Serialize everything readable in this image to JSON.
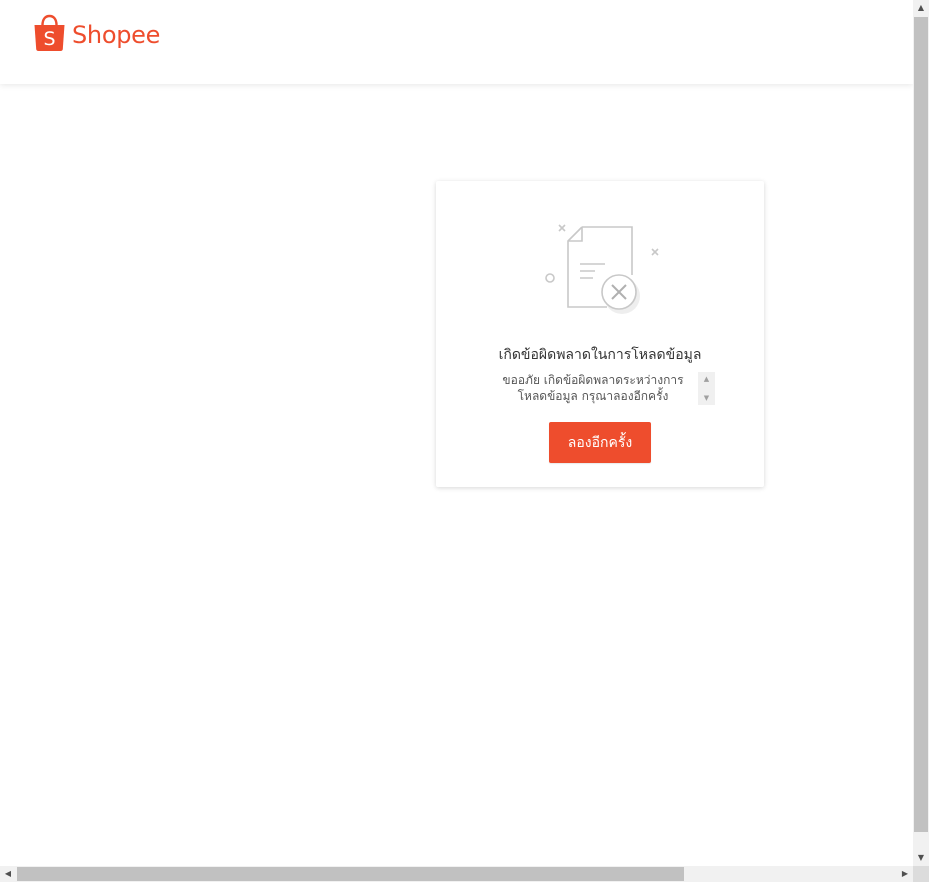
{
  "header": {
    "logo_text": "Shopee",
    "logo_bag_letter": "S"
  },
  "error_card": {
    "illustration": "document-error-icon",
    "title": "เกิดข้อผิดพลาดในการโหลดข้อมูล",
    "message_line1": "ขออภัย เกิดข้อผิดพลาดระหว่างการ",
    "message_line2": "โหลดข้อมูล กรุณาลองอีกครั้ง",
    "retry_label": "ลองอีกครั้ง"
  },
  "colors": {
    "brand": "#ee4d2d",
    "illustration_stroke": "#c8c8c8"
  }
}
